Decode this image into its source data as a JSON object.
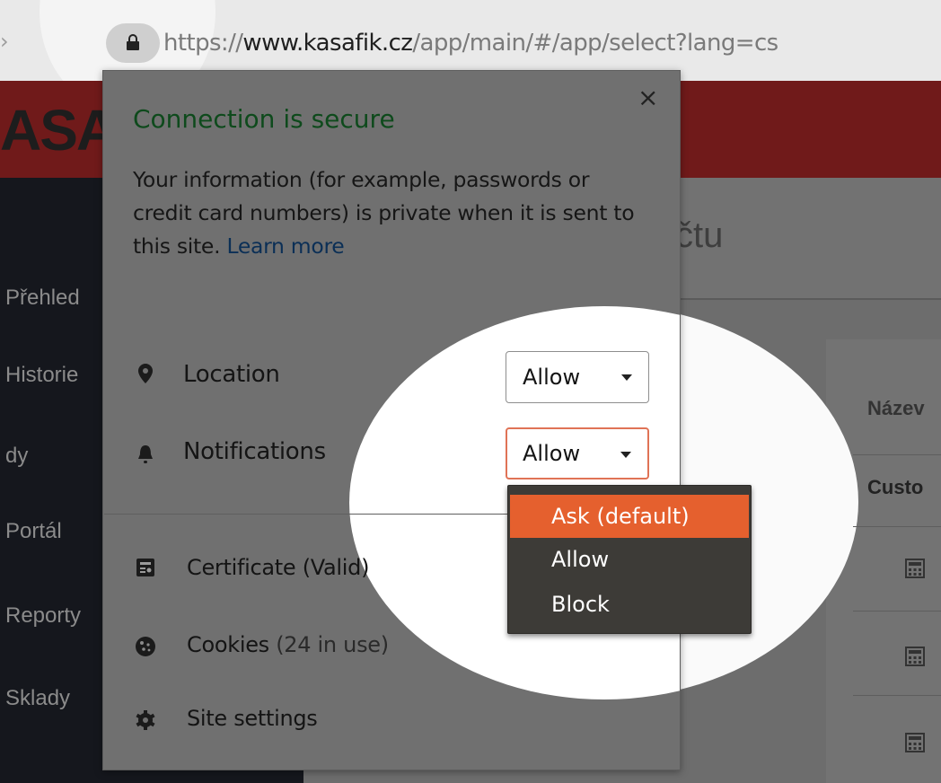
{
  "browser": {
    "url_scheme": "https://",
    "url_host": "www.kasafik.cz",
    "url_path": "/app/main/#/app/select?lang=cs"
  },
  "page": {
    "brand": "ASA",
    "heading": "čtu",
    "sidebar": [
      "Přehled",
      "Historie",
      "dy",
      "Portál",
      "Reporty",
      "Sklady"
    ],
    "table_header": "Název",
    "row_name": "Custo"
  },
  "popup": {
    "title": "Connection is secure",
    "description": "Your information (for example, passwords or credit card numbers) is private when it is sent to this site.",
    "learn_more": "Learn more",
    "close": "×",
    "permissions": [
      {
        "label": "Location",
        "value": "Allow",
        "icon": "location-pin-icon"
      },
      {
        "label": "Notifications",
        "value": "Allow",
        "icon": "bell-icon"
      }
    ],
    "links": {
      "certificate": "Certificate (Valid)",
      "cookies_label": "Cookies",
      "cookies_count": "(24 in use)",
      "site_settings": "Site settings"
    }
  },
  "dropdown": {
    "options": [
      "Ask (default)",
      "Allow",
      "Block"
    ],
    "highlighted": "Ask (default)"
  },
  "colors": {
    "secure_green": "#0e4a1c",
    "menu_highlight": "#e5602e",
    "menu_bg": "#3d3b37",
    "focus_border": "#e07356"
  }
}
